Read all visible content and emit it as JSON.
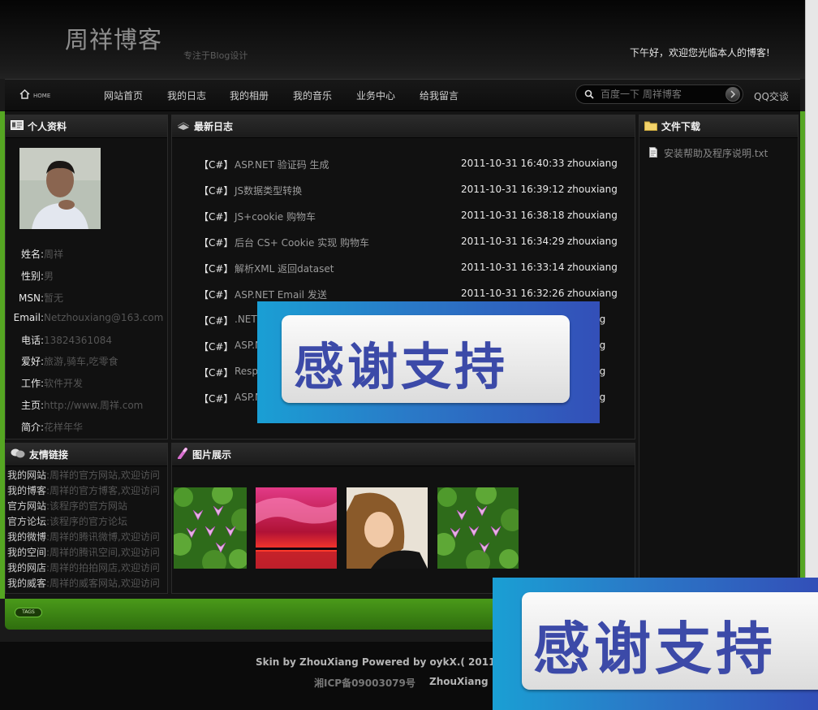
{
  "header": {
    "site_title": "周祥博客",
    "subtitle": "专注于Blog设计",
    "greeting": "下午好，欢迎您光临本人的博客!"
  },
  "nav": {
    "home_label": "HOME",
    "items": [
      "网站首页",
      "我的日志",
      "我的相册",
      "我的音乐",
      "业务中心",
      "给我留言"
    ],
    "search_placeholder": "百度一下 周祥博客",
    "qq_label": "QQ交谈"
  },
  "profile": {
    "title": "个人资料",
    "fields": [
      {
        "k": "姓名:",
        "v": "周祥"
      },
      {
        "k": "性别:",
        "v": "男"
      },
      {
        "k": "MSN:",
        "v": "暂无"
      },
      {
        "k": "Email:",
        "v": "Netzhouxiang@163.com"
      },
      {
        "k": "电话:",
        "v": "13824361084"
      },
      {
        "k": "爱好:",
        "v": "旅游,骑车,吃零食"
      },
      {
        "k": "工作:",
        "v": "软件开发"
      },
      {
        "k": "主页:",
        "v": "http://www.周祥.com"
      },
      {
        "k": "简介:",
        "v": "花样年华"
      }
    ]
  },
  "links": {
    "title": "友情链接",
    "items": [
      {
        "k": "我的网站",
        "v": ":周祥的官方网站,欢迎访问"
      },
      {
        "k": "我的博客",
        "v": ":周祥的官方博客,欢迎访问"
      },
      {
        "k": "官方网站",
        "v": ":该程序的官方网站"
      },
      {
        "k": "官方论坛",
        "v": ":该程序的官方论坛"
      },
      {
        "k": "我的微博",
        "v": ":周祥的腾讯微博,欢迎访问"
      },
      {
        "k": "我的空间",
        "v": ":周祥的腾讯空间,欢迎访问"
      },
      {
        "k": "我的网店",
        "v": ":周祥的拍拍网店,欢迎访问"
      },
      {
        "k": "我的威客",
        "v": ":周祥的威客网站,欢迎访问"
      }
    ]
  },
  "latest": {
    "title": "最新日志",
    "entries": [
      {
        "cat": "【C#】",
        "title": "ASP.NET 验证码 生成",
        "date": "2011-10-31 16:40:33",
        "author": "zhouxiang"
      },
      {
        "cat": "【C#】",
        "title": "JS数据类型转换",
        "date": "2011-10-31 16:39:12",
        "author": "zhouxiang"
      },
      {
        "cat": "【C#】",
        "title": "JS+cookie 购物车",
        "date": "2011-10-31 16:38:18",
        "author": "zhouxiang"
      },
      {
        "cat": "【C#】",
        "title": "后台 CS+ Cookie 实现 购物车",
        "date": "2011-10-31 16:34:29",
        "author": "zhouxiang"
      },
      {
        "cat": "【C#】",
        "title": "解析XML 返回dataset",
        "date": "2011-10-31 16:33:14",
        "author": "zhouxiang"
      },
      {
        "cat": "【C#】",
        "title": "ASP.NET Email 发送",
        "date": "2011-10-31 16:32:26",
        "author": "zhouxiang"
      },
      {
        "cat": "【C#】",
        "title": ".NET",
        "date": "",
        "author": "ng"
      },
      {
        "cat": "【C#】",
        "title": "ASP.N",
        "date": "",
        "author": "ng"
      },
      {
        "cat": "【C#】",
        "title": "Respo",
        "date": "",
        "author": "ng"
      },
      {
        "cat": "【C#】",
        "title": "ASP.N",
        "date": "",
        "author": "ng"
      }
    ]
  },
  "gallery": {
    "title": "图片展示"
  },
  "files": {
    "title": "文件下载",
    "item": "安装帮助及程序说明.txt"
  },
  "tags": {
    "label": "TAGS"
  },
  "footer": {
    "line1": "Skin by ZhouXiang Powered by oykX.( 2011",
    "icp": "湘ICP备09003079号",
    "author": "ZhouXiang"
  },
  "banner": {
    "text": "感谢支持"
  }
}
